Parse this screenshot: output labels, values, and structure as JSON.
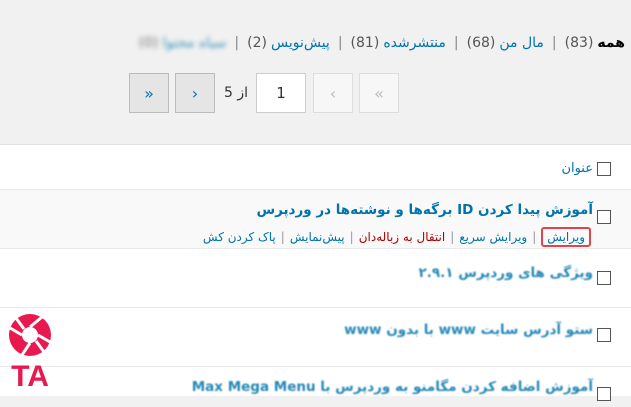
{
  "filters": [
    {
      "label": "همه",
      "count": "(83)",
      "current": true
    },
    {
      "label": "مال من",
      "count": "(68)"
    },
    {
      "label": "منتشرشده",
      "count": "(81)"
    },
    {
      "label": "پیش‌نویس",
      "count": "(2)"
    },
    {
      "label": "سیاه محتوا",
      "count": "(0)",
      "blurred": true
    }
  ],
  "pagination": {
    "first": "«",
    "prev": "‹",
    "current_page": "1",
    "of_text": "از 5",
    "next": "›",
    "last": "»"
  },
  "table": {
    "column_title": "عنوان",
    "rows": [
      {
        "title": "آموزش پیدا کردن ID برگه‌ها و نوشته‌ها در وردپرس"
      },
      {
        "title": "ویژگی های وردپرس ۲.۹.۱"
      },
      {
        "title": "ستو آدرس سایت www با بدون www"
      },
      {
        "title": "آموزش اضافه کردن مگامنو به وردپرس با Max Mega Menu"
      }
    ],
    "row_actions": [
      "ویرایش",
      "ویرایش سریع",
      "انتقال به زباله‌دان",
      "پیش‌نمایش",
      "پاک کردن کش"
    ]
  },
  "logo": {
    "text": "TA",
    "color": "#e8194f"
  }
}
